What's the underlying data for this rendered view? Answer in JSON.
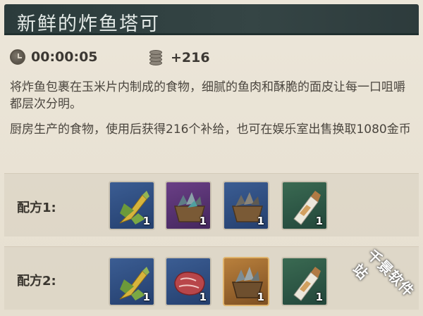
{
  "title": "新鲜的炸鱼塔可",
  "stats": {
    "time_icon": "clock-icon",
    "time": "00:00:05",
    "supply_icon": "coins-icon",
    "supply": "+216"
  },
  "description": [
    "将炸鱼包裹在玉米片内制成的食物，细腻的鱼肉和酥脆的面皮让每一口咀嚼都层次分明。",
    "厨房生产的食物，使用后获得216个补给，也可在娱乐室出售换取1080金币"
  ],
  "recipes": [
    {
      "label": "配方1:",
      "items": [
        {
          "icon": "corn-icon",
          "rarity": "blue",
          "qty": "1"
        },
        {
          "icon": "fish-basket-icon",
          "rarity": "purple",
          "qty": "1"
        },
        {
          "icon": "fish-basket-icon",
          "rarity": "blue",
          "qty": "1"
        },
        {
          "icon": "salt-bottle-icon",
          "rarity": "green",
          "qty": "1"
        }
      ]
    },
    {
      "label": "配方2:",
      "items": [
        {
          "icon": "corn-icon",
          "rarity": "blue",
          "qty": "1"
        },
        {
          "icon": "meat-steak-icon",
          "rarity": "blue",
          "qty": "1"
        },
        {
          "icon": "fish-basket-icon",
          "rarity": "orange",
          "qty": "1"
        },
        {
          "icon": "salt-bottle-icon",
          "rarity": "green",
          "qty": "1"
        }
      ]
    }
  ],
  "watermark": "千景软件站",
  "colors": {
    "title_bar": "#2b3b3b",
    "background": "#e9e3d6",
    "rarity_blue": "#2f4f82",
    "rarity_purple": "#583374",
    "rarity_green": "#2e5846",
    "rarity_orange": "#a8722f"
  }
}
